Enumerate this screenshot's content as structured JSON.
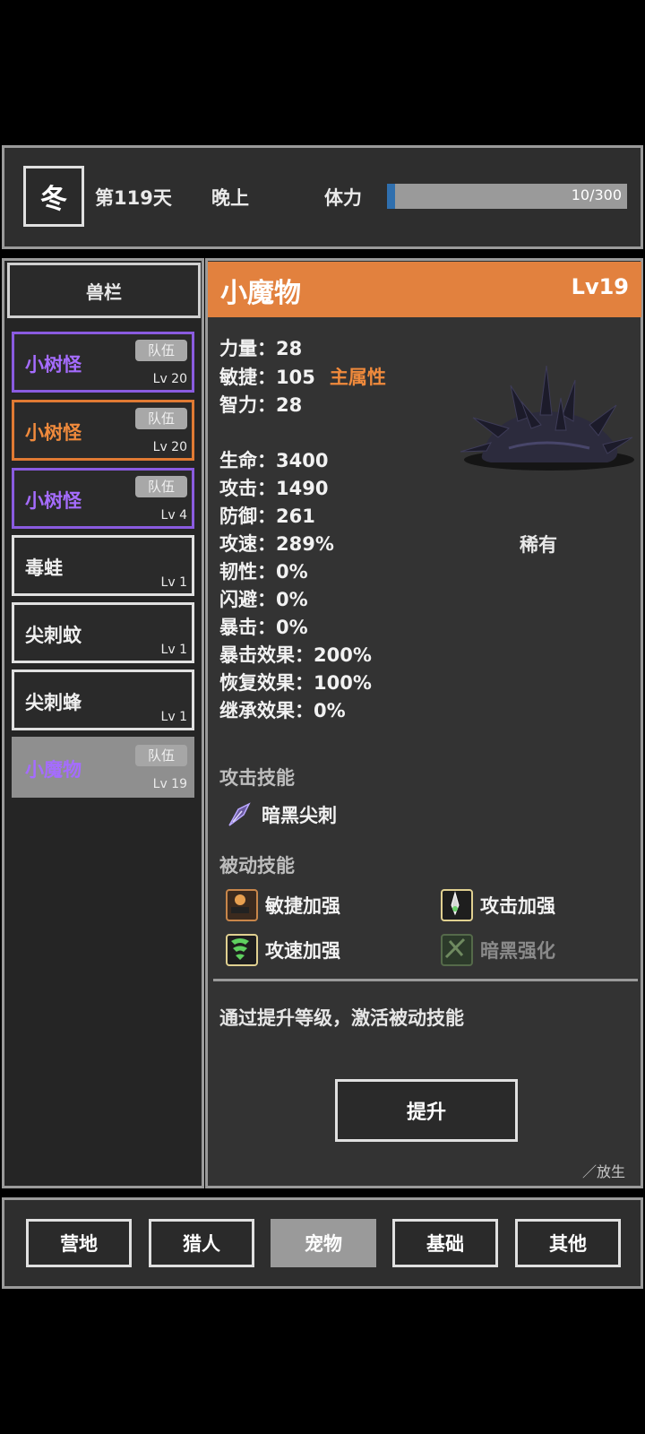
{
  "header": {
    "season": "冬",
    "day": "第119天",
    "time_of_day": "晚上",
    "stamina_label": "体力",
    "stamina_text": "10/300",
    "stamina_fraction": 0.033,
    "stamina_color": "#2f6fae"
  },
  "pet_list": {
    "title": "兽栏",
    "items": [
      {
        "name": "小树怪",
        "badge": "队伍",
        "level": "Lv 20",
        "style": "purple"
      },
      {
        "name": "小树怪",
        "badge": "队伍",
        "level": "Lv 20",
        "style": "orange"
      },
      {
        "name": "小树怪",
        "badge": "队伍",
        "level": "Lv 4",
        "style": "purple"
      },
      {
        "name": "毒蛙",
        "badge": "",
        "level": "Lv 1",
        "style": "plain"
      },
      {
        "name": "尖刺蚊",
        "badge": "",
        "level": "Lv 1",
        "style": "plain"
      },
      {
        "name": "尖刺蜂",
        "badge": "",
        "level": "Lv 1",
        "style": "plain"
      },
      {
        "name": "小魔物",
        "badge": "队伍",
        "level": "Lv 19",
        "style": "active"
      }
    ]
  },
  "detail": {
    "name": "小魔物",
    "level": "Lv19",
    "title_color": "#e2813e",
    "stats": {
      "strength": "力量：28",
      "agility": "敏捷：105",
      "main_attr": "主属性",
      "intelligence": "智力：28",
      "hp": "生命：3400",
      "attack": "攻击：1490",
      "defense": "防御：261",
      "attack_speed": "攻速：289%",
      "toughness": "韧性：0%",
      "dodge": "闪避：0%",
      "crit": "暴击：0%",
      "crit_effect": "暴击效果：200%",
      "recovery_effect": "恢复效果：100%",
      "inherit_effect": "继承效果：0%"
    },
    "rarity": "稀有",
    "attack_skills_title": "攻击技能",
    "attack_skill": {
      "name": "暗黑尖刺",
      "icon": "dark-spike-icon"
    },
    "passive_skills_title": "被动技能",
    "passive_skills": [
      {
        "name": "敏捷加强",
        "icon": "agility-boost-icon",
        "active": true
      },
      {
        "name": "攻击加强",
        "icon": "attack-boost-icon",
        "active": true
      },
      {
        "name": "攻速加强",
        "icon": "attack-speed-boost-icon",
        "active": true
      },
      {
        "name": "暗黑强化",
        "icon": "dark-enhance-icon",
        "active": false
      }
    ],
    "hint": "通过提升等级，激活被动技能",
    "upgrade_label": "提升",
    "release_label": "放生"
  },
  "nav": {
    "tabs": [
      {
        "label": "营地",
        "selected": false
      },
      {
        "label": "猎人",
        "selected": false
      },
      {
        "label": "宠物",
        "selected": true
      },
      {
        "label": "基础",
        "selected": false
      },
      {
        "label": "其他",
        "selected": false
      }
    ]
  }
}
